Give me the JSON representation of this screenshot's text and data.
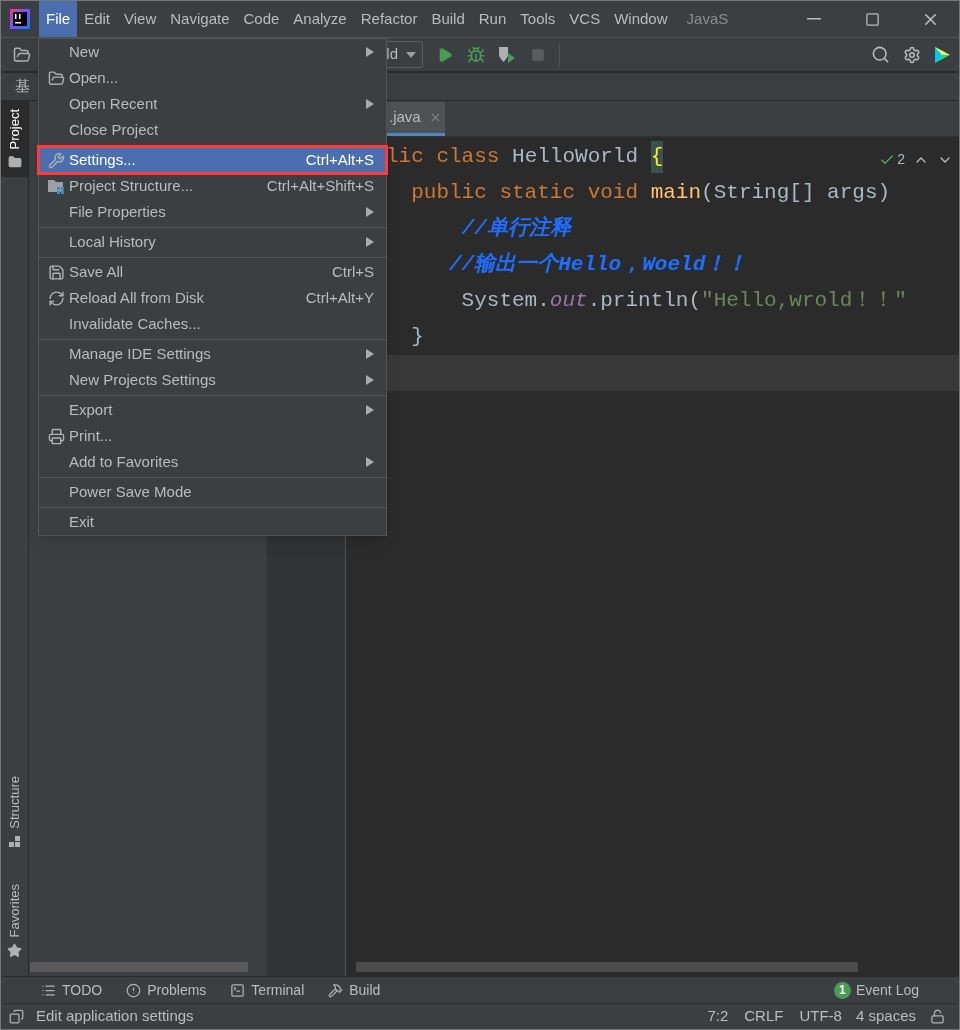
{
  "window": {
    "title": "JavaS"
  },
  "menu_bar": [
    {
      "label": "File",
      "selected": true
    },
    {
      "label": "Edit",
      "selected": false
    },
    {
      "label": "View",
      "selected": false
    },
    {
      "label": "Navigate",
      "selected": false
    },
    {
      "label": "Code",
      "selected": false
    },
    {
      "label": "Analyze",
      "selected": false
    },
    {
      "label": "Refactor",
      "selected": false
    },
    {
      "label": "Build",
      "selected": false
    },
    {
      "label": "Run",
      "selected": false
    },
    {
      "label": "Tools",
      "selected": false
    },
    {
      "label": "VCS",
      "selected": false
    },
    {
      "label": "Window",
      "selected": false
    }
  ],
  "toolbar": {
    "run_configuration": "ld"
  },
  "nav_bar": {
    "path": "基"
  },
  "editor_tab": {
    "label": ".java"
  },
  "tool_stripe": [
    {
      "label": "Project",
      "selected": true
    },
    {
      "label": "Structure",
      "selected": false
    },
    {
      "label": "Favorites",
      "selected": false
    }
  ],
  "file_menu": [
    {
      "kind": "item",
      "label": "New",
      "submenu": true,
      "selected": false,
      "outlined": false
    },
    {
      "kind": "item",
      "label": "Open...",
      "submenu": false,
      "selected": false,
      "outlined": false
    },
    {
      "kind": "item",
      "label": "Open Recent",
      "submenu": true,
      "selected": false,
      "outlined": false
    },
    {
      "kind": "item",
      "label": "Close Project",
      "submenu": false,
      "selected": false,
      "outlined": false
    },
    {
      "kind": "separator"
    },
    {
      "kind": "item",
      "label": "Settings...",
      "shortcut": "Ctrl+Alt+S",
      "submenu": false,
      "selected": true,
      "outlined": true
    },
    {
      "kind": "item",
      "label": "Project Structure...",
      "shortcut": "Ctrl+Alt+Shift+S",
      "submenu": false,
      "selected": false,
      "outlined": false
    },
    {
      "kind": "item",
      "label": "File Properties",
      "submenu": true,
      "selected": false,
      "outlined": false
    },
    {
      "kind": "separator"
    },
    {
      "kind": "item",
      "label": "Local History",
      "submenu": true,
      "selected": false,
      "outlined": false
    },
    {
      "kind": "separator"
    },
    {
      "kind": "item",
      "label": "Save All",
      "shortcut": "Ctrl+S",
      "submenu": false,
      "selected": false,
      "outlined": false
    },
    {
      "kind": "item",
      "label": "Reload All from Disk",
      "shortcut": "Ctrl+Alt+Y",
      "submenu": false,
      "selected": false,
      "outlined": false
    },
    {
      "kind": "item",
      "label": "Invalidate Caches...",
      "submenu": false,
      "selected": false,
      "outlined": false
    },
    {
      "kind": "separator"
    },
    {
      "kind": "item",
      "label": "Manage IDE Settings",
      "submenu": true,
      "selected": false,
      "outlined": false
    },
    {
      "kind": "item",
      "label": "New Projects Settings",
      "submenu": true,
      "selected": false,
      "outlined": false
    },
    {
      "kind": "separator"
    },
    {
      "kind": "item",
      "label": "Export",
      "submenu": true,
      "selected": false,
      "outlined": false
    },
    {
      "kind": "item",
      "label": "Print...",
      "submenu": false,
      "selected": false,
      "outlined": false
    },
    {
      "kind": "item",
      "label": "Add to Favorites",
      "submenu": true,
      "selected": false,
      "outlined": false
    },
    {
      "kind": "separator"
    },
    {
      "kind": "item",
      "label": "Power Save Mode",
      "submenu": false,
      "selected": false,
      "outlined": false
    },
    {
      "kind": "separator"
    },
    {
      "kind": "item",
      "label": "Exit",
      "submenu": false,
      "selected": false,
      "outlined": false
    }
  ],
  "editor": {
    "warnings": "2",
    "lines": [
      {
        "current": false,
        "tokens": [
          {
            "kind": "keyword",
            "text": "lic class "
          },
          {
            "kind": "plain",
            "text": "HelloWorld "
          },
          {
            "kind": "brace",
            "text": "{"
          }
        ]
      },
      {
        "current": false,
        "tokens": [
          {
            "kind": "keyword",
            "text": "  public static void "
          },
          {
            "kind": "method",
            "text": "main"
          },
          {
            "kind": "plain",
            "text": "(String[] args)"
          }
        ]
      },
      {
        "current": false,
        "tokens": [
          {
            "kind": "comment",
            "text": "      //单行注释"
          }
        ]
      },
      {
        "current": false,
        "tokens": [
          {
            "kind": "comment",
            "text": "     //输出一个Hello，Woeld！！"
          }
        ]
      },
      {
        "current": false,
        "tokens": [
          {
            "kind": "plain",
            "text": "      System."
          },
          {
            "kind": "field",
            "text": "out"
          },
          {
            "kind": "plain",
            "text": ".println("
          },
          {
            "kind": "string",
            "text": "\"Hello,wrold！！\""
          }
        ]
      },
      {
        "current": false,
        "tokens": [
          {
            "kind": "plain",
            "text": "  }"
          }
        ]
      },
      {
        "current": true
      }
    ]
  },
  "tool_windows": [
    {
      "label": "TODO"
    },
    {
      "label": "Problems"
    },
    {
      "label": "Terminal"
    },
    {
      "label": "Build"
    }
  ],
  "event_log": {
    "count": "1",
    "label": "Event Log"
  },
  "status_bar": {
    "message": "Edit application settings",
    "position": "7:2",
    "line_separator": "CRLF",
    "encoding": "UTF-8",
    "indent": "4 spaces"
  }
}
